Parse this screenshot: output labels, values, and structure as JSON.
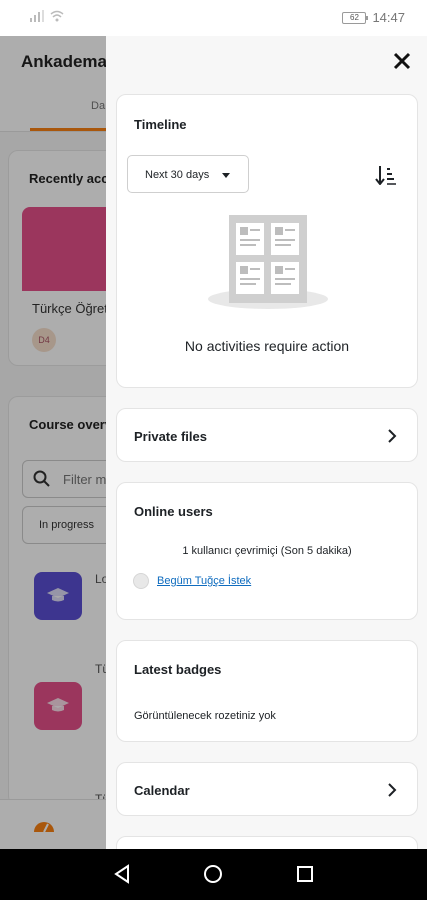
{
  "status_bar": {
    "time": "14:47",
    "battery": "62"
  },
  "background": {
    "app_title": "Ankadema",
    "tab_label": "Da",
    "recently_accessed": "Recently acc",
    "course_name": "Türkçe Öğret",
    "course_chip": "D4",
    "course_overview": "Course overv",
    "filter_placeholder": "Filter m",
    "progress_select": "In progress",
    "list_item_1": "Lo",
    "list_item_2": "Tü",
    "list_item_3": "Tü"
  },
  "drawer": {
    "timeline": {
      "title": "Timeline",
      "filter": "Next 30 days",
      "empty_message": "No activities require action"
    },
    "private_files": {
      "title": "Private files"
    },
    "online_users": {
      "title": "Online users",
      "summary": "1 kullanıcı çevrimiçi (Son 5 dakika)",
      "users": [
        "Begüm Tuğçe İstek"
      ]
    },
    "latest_badges": {
      "title": "Latest badges",
      "empty_message": "Görüntülenecek rozetiniz yok"
    },
    "calendar": {
      "title": "Calendar"
    }
  },
  "colors": {
    "accent": "#f98012",
    "link": "#0f6cbf",
    "course_banner": "#e5508a",
    "course_icon_purple": "#5b4fd3"
  }
}
